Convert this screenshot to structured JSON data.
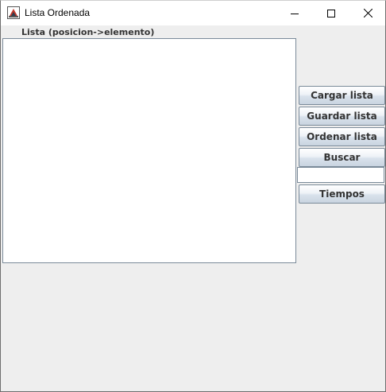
{
  "window": {
    "title": "Lista Ordenada",
    "controls": {
      "minimize": "minimize-icon",
      "maximize": "maximize-icon",
      "close": "close-icon"
    }
  },
  "list": {
    "label": "Lista (posicion->elemento)",
    "items": []
  },
  "buttons": {
    "load": "Cargar lista",
    "save": "Guardar lista",
    "sort": "Ordenar lista",
    "search": "Buscar",
    "times": "Tiempos"
  },
  "search_field": {
    "value": "",
    "placeholder": ""
  },
  "colors": {
    "background": "#eeeeee",
    "button_border": "#7a8a99",
    "label_text": "#333333"
  }
}
